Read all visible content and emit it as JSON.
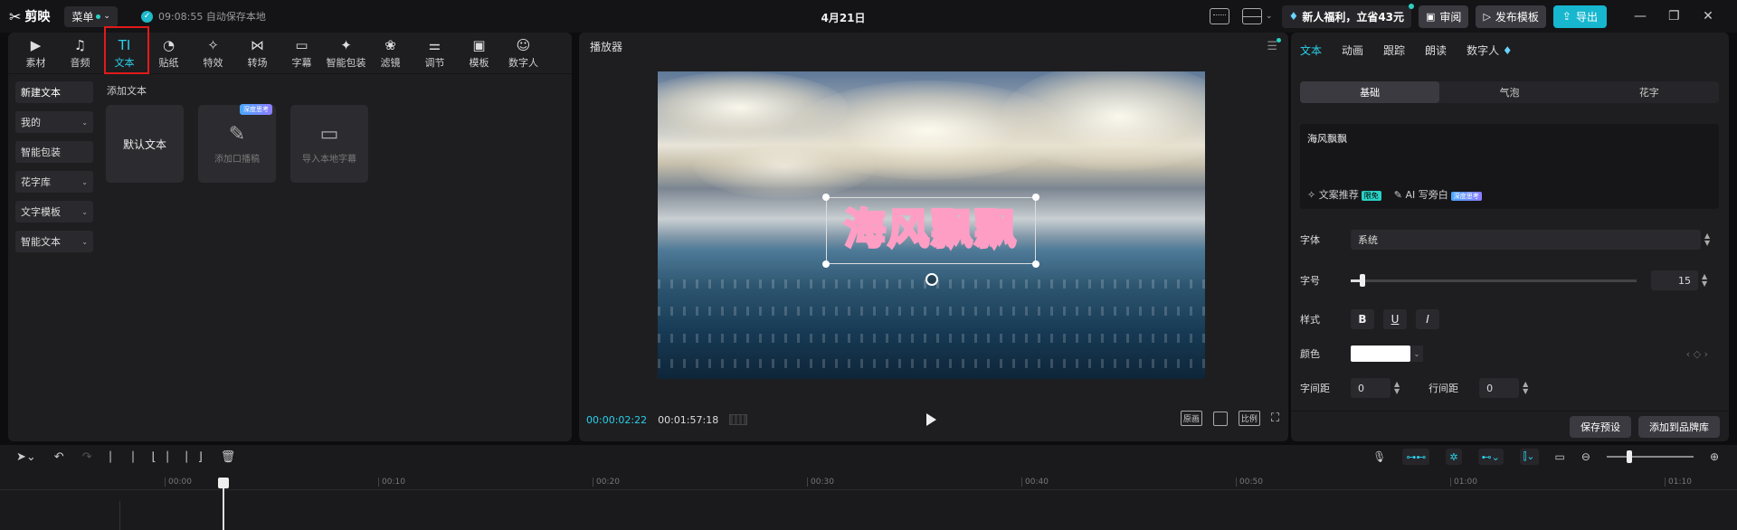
{
  "app": {
    "name": "剪映",
    "menu_label": "菜单",
    "autosave": "09:08:55 自动保存本地",
    "title": "4月21日"
  },
  "topbar": {
    "promo": "新人福利，立省43元",
    "review": "审阅",
    "publish": "发布模板",
    "export": "导出"
  },
  "toolbar": {
    "tabs": [
      {
        "label": "素材",
        "icon": "media-icon",
        "glyph": "▶"
      },
      {
        "label": "音频",
        "icon": "audio-icon",
        "glyph": "♫"
      },
      {
        "label": "文本",
        "icon": "text-icon",
        "glyph": "TI"
      },
      {
        "label": "贴纸",
        "icon": "sticker-icon",
        "glyph": "◔"
      },
      {
        "label": "特效",
        "icon": "effects-icon",
        "glyph": "✧"
      },
      {
        "label": "转场",
        "icon": "transition-icon",
        "glyph": "⋈"
      },
      {
        "label": "字幕",
        "icon": "subtitle-icon",
        "glyph": "▭"
      },
      {
        "label": "智能包装",
        "icon": "smart-pack-icon",
        "glyph": "✦"
      },
      {
        "label": "滤镜",
        "icon": "filter-icon",
        "glyph": "❀"
      },
      {
        "label": "调节",
        "icon": "adjust-icon",
        "glyph": "⚌"
      },
      {
        "label": "模板",
        "icon": "template-icon",
        "glyph": "▣"
      },
      {
        "label": "数字人",
        "icon": "digital-human-icon",
        "glyph": "☺"
      }
    ],
    "active_index": 2
  },
  "text_panel": {
    "side_items": [
      {
        "label": "新建文本",
        "dropdown": ""
      },
      {
        "label": "我的",
        "dropdown": "⌄"
      },
      {
        "label": "智能包装",
        "dropdown": ""
      },
      {
        "label": "花字库",
        "dropdown": "⌄"
      },
      {
        "label": "文字模板",
        "dropdown": "⌄"
      },
      {
        "label": "智能文本",
        "dropdown": "⌄"
      }
    ],
    "section_label": "添加文本",
    "cards": [
      {
        "label": "默认文本"
      },
      {
        "label": "添加口播稿",
        "badge": "深度思考"
      },
      {
        "label": "导入本地字幕"
      }
    ]
  },
  "player": {
    "title": "播放器",
    "caption": "海风飘飘",
    "current_time": "00:00:02:22",
    "duration": "00:01:57:18",
    "btn_original": "原画",
    "btn_ratio": "比例"
  },
  "right_panel": {
    "tabs": [
      "文本",
      "动画",
      "跟踪",
      "朗读",
      "数字人"
    ],
    "sub_tabs": [
      "基础",
      "气泡",
      "花字"
    ],
    "text_value": "海风飘飘",
    "copy_suggest": "文案推荐",
    "copy_badge": "限免",
    "ai_narration": "AI 写旁白",
    "ai_badge": "深度思考",
    "font_label": "字体",
    "font_value": "系统",
    "size_label": "字号",
    "size_value": "15",
    "style_label": "样式",
    "color_label": "颜色",
    "color_value": "#ffffff",
    "char_spacing_label": "字间距",
    "char_spacing_value": "0",
    "line_spacing_label": "行间距",
    "line_spacing_value": "0",
    "save_preset": "保存预设",
    "add_brand": "添加到品牌库"
  },
  "timeline": {
    "ticks": [
      "00:00",
      "00:10",
      "00:20",
      "00:30",
      "00:40",
      "00:50",
      "01:00",
      "01:10"
    ],
    "accent": "#2ad1ea"
  }
}
